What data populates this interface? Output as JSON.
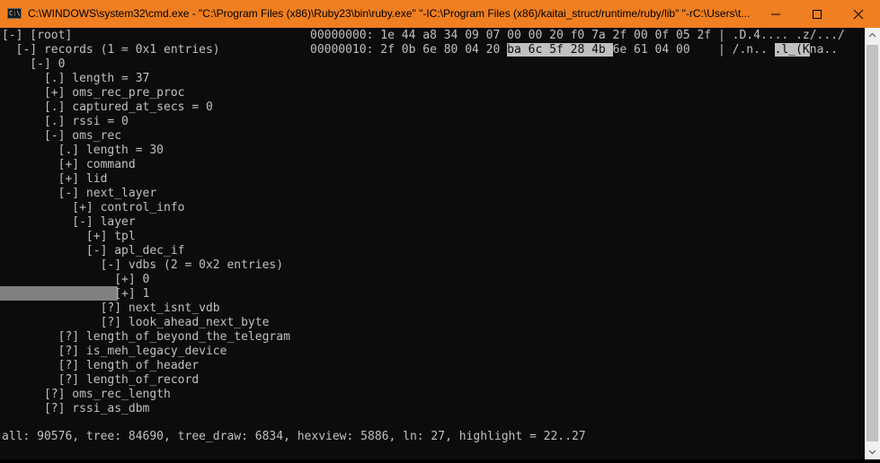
{
  "window": {
    "title": "C:\\WINDOWS\\system32\\cmd.exe - \"C:\\Program Files (x86)\\Ruby23\\bin\\ruby.exe\"  \"-IC:\\Program Files (x86)/kaitai_struct/runtime/ruby/lib\" \"-rC:\\Users\\t...",
    "icon": "cmd-icon",
    "icon_text": "C:\\",
    "accent_color": "#f07f21"
  },
  "tree": [
    "[-] [root]",
    "  [-] records (1 = 0x1 entries)",
    "    [-] 0",
    "      [.] length = 37",
    "      [+] oms_rec_pre_proc",
    "      [.] captured_at_secs = 0",
    "      [.] rssi = 0",
    "      [-] oms_rec",
    "        [.] length = 30",
    "        [+] command",
    "        [+] lid",
    "        [-] next_layer",
    "          [+] control_info",
    "          [-] layer",
    "            [+] tpl",
    "            [-] apl_dec_if",
    "              [-] vdbs (2 = 0x2 entries)",
    "                [+] 0",
    "                [+] 1",
    "              [?] next_isnt_vdb",
    "              [?] look_ahead_next_byte",
    "        [?] length_of_beyond_the_telegram",
    "        [?] is_meh_legacy_device",
    "        [?] length_of_header",
    "        [?] length_of_record",
    "      [?] oms_rec_length",
    "      [?] rssi_as_dbm"
  ],
  "hex": {
    "row1": {
      "offset": "00000000:",
      "bytes": "1e 44 a8 34 09 07 00 00 20 f0 7a 2f 00 0f 05 2f",
      "ascii": ".D.4.... .z/.../"
    },
    "row2": {
      "offset": "00000010:",
      "bytes_pre": "2f 0b 6e 80 04 20 ",
      "bytes_hl": "ba 6c 5f 28 4b ",
      "bytes_post": "6e 61 04 00",
      "ascii_pre": "/.n.. ",
      "ascii_hl": ".l_(K",
      "ascii_post": "na.."
    }
  },
  "status": "all: 90576, tree: 84690, tree_draw: 6834, hexview: 5886, ln: 27, highlight = 22..27",
  "colors": {
    "console_bg": "#0c0c0c",
    "console_fg": "#c0c0c0",
    "selection_bar": "#808080",
    "highlight_bg": "#c0c0c0"
  }
}
